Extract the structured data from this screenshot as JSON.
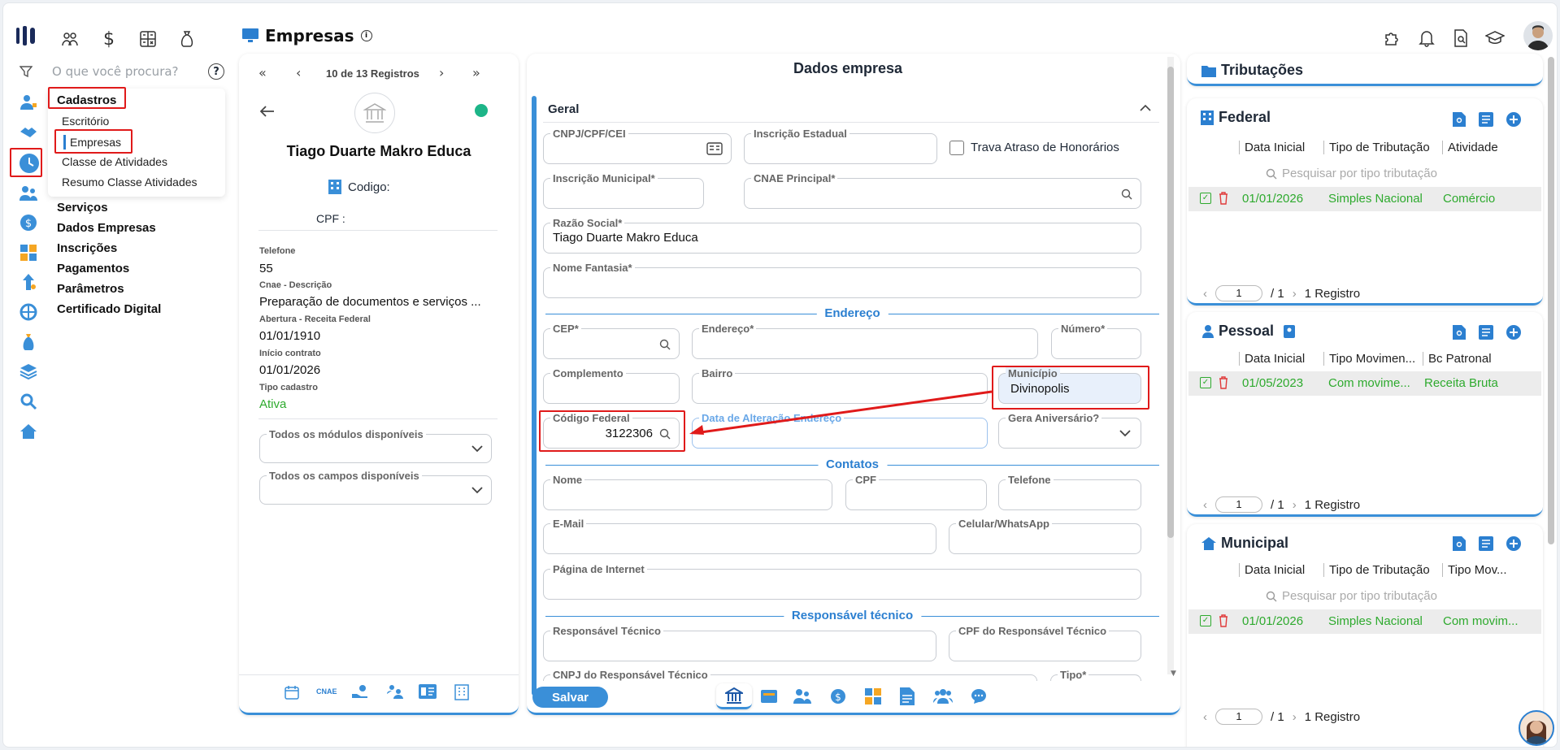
{
  "header": {
    "title": "Empresas"
  },
  "search": {
    "placeholder": "O que você procura?"
  },
  "sidebar": {
    "submenu_title": "Cadastros",
    "submenu_items": [
      "Escritório",
      "Empresas",
      "Classe de Atividades",
      "Resumo Classe Atividades"
    ],
    "menu": [
      "Serviços",
      "Dados Empresas",
      "Inscrições",
      "Pagamentos",
      "Parâmetros",
      "Certificado Digital"
    ]
  },
  "record": {
    "nav_text": "10 de 13 Registros",
    "name": "Tiago Duarte Makro Educa",
    "codigo_label": "Codigo:",
    "cpf_label": "CPF :",
    "telefone_label": "Telefone",
    "telefone": "55",
    "cnae_label": "Cnae - Descrição",
    "cnae": "Preparação de documentos e serviços ...",
    "abertura_label": "Abertura - Receita Federal",
    "abertura": "01/01/1910",
    "inicio_label": "Início contrato",
    "inicio": "01/01/2026",
    "tipo_label": "Tipo cadastro",
    "tipo": "Ativa",
    "modulos": "Todos os módulos disponíveis",
    "campos": "Todos os campos disponíveis",
    "bottom_cnae": "CNAE"
  },
  "form": {
    "title": "Dados empresa",
    "section_geral": "Geral",
    "cnpj_label": "CNPJ/CPF/CEI",
    "ie_label": "Inscrição Estadual",
    "trava_label": "Trava Atraso de Honorários",
    "im_label": "Inscrição Municipal*",
    "cnae_label": "CNAE Principal*",
    "razao_label": "Razão Social*",
    "razao_value": "Tiago Duarte Makro Educa",
    "fantasia_label": "Nome Fantasia*",
    "section_endereco": "Endereço",
    "cep_label": "CEP*",
    "endereco_label": "Endereço*",
    "numero_label": "Número*",
    "complemento_label": "Complemento",
    "bairro_label": "Bairro",
    "municipio_label": "Município",
    "municipio_value": "Divinopolis",
    "codfed_label": "Código Federal",
    "codfed_value": "3122306",
    "data_alt_label": "Data de Alteração Endereço",
    "gera_label": "Gera Aniversário?",
    "section_contatos": "Contatos",
    "nome_label": "Nome",
    "cpf_label": "CPF",
    "telefone_label": "Telefone",
    "email_label": "E-Mail",
    "celular_label": "Celular/WhatsApp",
    "pagina_label": "Página de Internet",
    "section_resp": "Responsável técnico",
    "resp_label": "Responsável Técnico",
    "cpf_resp_label": "CPF do Responsável Técnico",
    "cnpj_resp_label": "CNPJ do Responsável Técnico",
    "tipo_label": "Tipo*",
    "save": "Salvar"
  },
  "tributacoes": {
    "title": "Tributações",
    "federal": {
      "title": "Federal",
      "cols": [
        "Data Inicial",
        "Tipo de Tributação",
        "Atividade"
      ],
      "search": "Pesquisar por tipo tributação",
      "row": [
        "01/01/2026",
        "Simples Nacional",
        "Comércio"
      ],
      "page": "1",
      "of": "/ 1",
      "count": "1 Registro"
    },
    "pessoal": {
      "title": "Pessoal",
      "cols": [
        "Data Inicial",
        "Tipo Movimen...",
        "Bc Patronal"
      ],
      "row": [
        "01/05/2023",
        "Com movime...",
        "Receita Bruta"
      ],
      "page": "1",
      "of": "/ 1",
      "count": "1 Registro"
    },
    "municipal": {
      "title": "Municipal",
      "cols": [
        "Data Inicial",
        "Tipo de Tributação",
        "Tipo Mov..."
      ],
      "search": "Pesquisar por tipo tributação",
      "row": [
        "01/01/2026",
        "Simples Nacional",
        "Com movim..."
      ],
      "page": "1",
      "of": "/ 1",
      "count": "1 Registro"
    }
  },
  "colors": {
    "accent": "#2b7fd0",
    "green": "#2eaa2e",
    "highlight": "#e01a1a"
  }
}
